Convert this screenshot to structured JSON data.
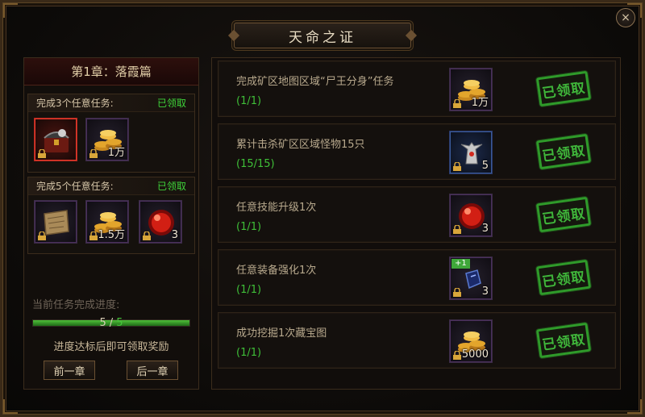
{
  "window": {
    "title": "天命之证",
    "close_glyph": "×"
  },
  "chapter": {
    "title": "第1章：落霞篇"
  },
  "groups": [
    {
      "label": "完成3个任意任务:",
      "status": "已领取",
      "rewards": [
        {
          "icon": "treasure-chest-icon",
          "qty": "",
          "highlight": true
        },
        {
          "icon": "gold-coins-icon",
          "qty": "1万",
          "highlight": false
        }
      ]
    },
    {
      "label": "完成5个任意任务:",
      "status": "已领取",
      "rewards": [
        {
          "icon": "scroll-map-icon",
          "qty": "",
          "highlight": false
        },
        {
          "icon": "gold-coins-icon",
          "qty": "1.5万",
          "highlight": false
        },
        {
          "icon": "red-orb-icon",
          "qty": "3",
          "highlight": false
        }
      ]
    }
  ],
  "progress": {
    "label": "当前任务完成进度:",
    "current": "5",
    "separator": "/",
    "total": "5",
    "fraction": 1.0,
    "hint": "进度达标后即可领取奖励"
  },
  "nav": {
    "prev_label": "前一章",
    "next_label": "后一章"
  },
  "tasks": [
    {
      "title": "完成矿区地图区域“尸王分身”任务",
      "progress": "(1/1)",
      "reward_icon": "gold-coins-icon",
      "reward_qty": "1万",
      "status": "已领取"
    },
    {
      "title": "累计击杀矿区区域怪物15只",
      "progress": "(15/15)",
      "reward_icon": "armor-figure-icon",
      "reward_qty": "5",
      "status": "已领取"
    },
    {
      "title": "任意技能升级1次",
      "progress": "(1/1)",
      "reward_icon": "red-orb-icon",
      "reward_qty": "3",
      "status": "已领取"
    },
    {
      "title": "任意装备强化1次",
      "progress": "(1/1)",
      "reward_icon": "enhance-stone-icon",
      "reward_qty": "3",
      "reward_tag": "+1",
      "status": "已领取"
    },
    {
      "title": "成功挖掘1次藏宝图",
      "progress": "(1/1)",
      "reward_icon": "gold-coins-icon",
      "reward_qty": "5000",
      "status": "已领取"
    }
  ],
  "colors": {
    "complete_green": "#3fbf38",
    "stamp_green": "#2f9b2a",
    "accent_red": "#b92a20",
    "text_gold": "#c9b89a"
  }
}
